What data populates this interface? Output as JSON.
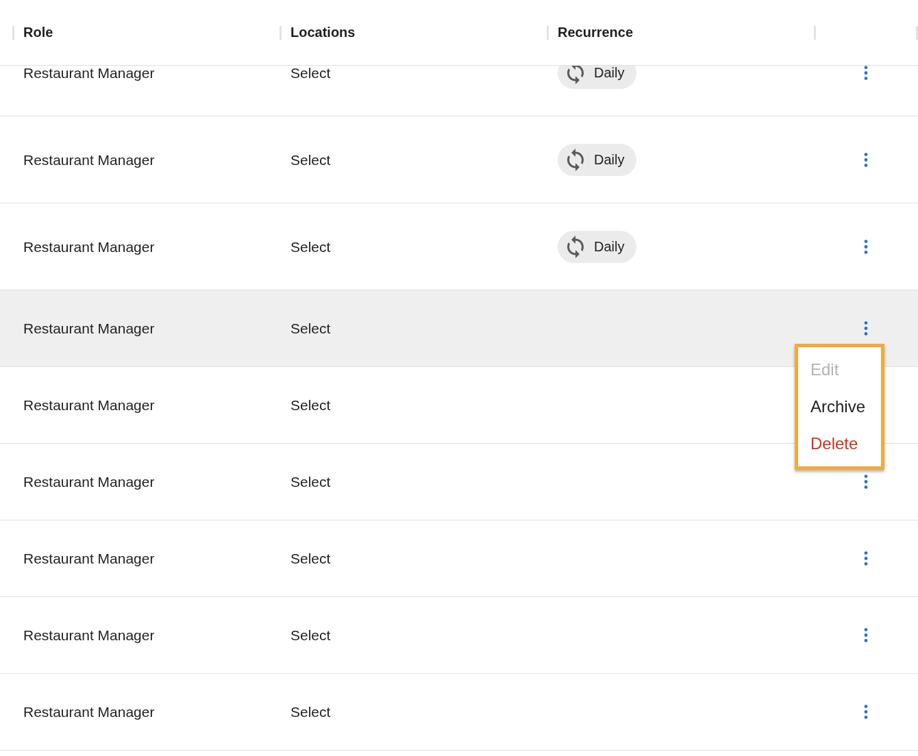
{
  "table": {
    "columns": [
      {
        "label": "Role"
      },
      {
        "label": "Locations"
      },
      {
        "label": "Recurrence"
      }
    ],
    "rows": [
      {
        "role": "Restaurant Manager",
        "locations": "Select",
        "recurrence": "Daily",
        "hovered": false
      },
      {
        "role": "Restaurant Manager",
        "locations": "Select",
        "recurrence": "Daily",
        "hovered": false
      },
      {
        "role": "Restaurant Manager",
        "locations": "Select",
        "recurrence": "Daily",
        "hovered": false
      },
      {
        "role": "Restaurant Manager",
        "locations": "Select",
        "hovered": true,
        "menu": {
          "items": [
            {
              "label": "Edit",
              "kind": "default",
              "disabled": true
            },
            {
              "label": "Archive",
              "kind": "default",
              "disabled": false
            },
            {
              "label": "Delete",
              "kind": "danger",
              "disabled": false
            }
          ]
        }
      },
      {
        "role": "Restaurant Manager",
        "locations": "Select",
        "hovered": false
      },
      {
        "role": "Restaurant Manager",
        "locations": "Select",
        "hovered": false
      },
      {
        "role": "Restaurant Manager",
        "locations": "Select",
        "hovered": false
      },
      {
        "role": "Restaurant Manager",
        "locations": "Select",
        "hovered": false
      },
      {
        "role": "Restaurant Manager",
        "locations": "Select",
        "hovered": false
      }
    ]
  }
}
